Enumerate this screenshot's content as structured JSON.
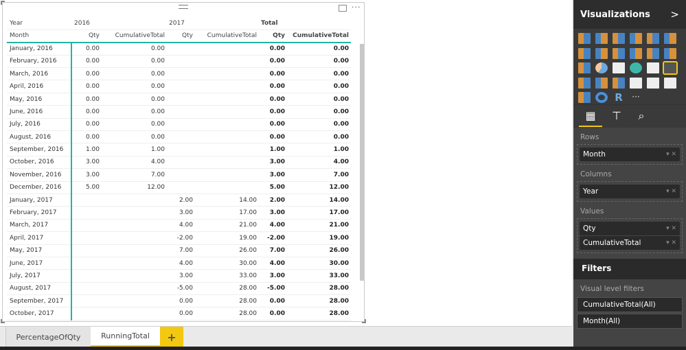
{
  "matrix": {
    "col_header": {
      "year_label": "Year",
      "y2016": "2016",
      "y2017": "2017",
      "total": "Total"
    },
    "sub_header": {
      "month_label": "Month",
      "qty": "Qty",
      "cum": "CumulativeTotal"
    },
    "rows": [
      [
        "January, 2016",
        "0.00",
        "0.00",
        "",
        "",
        "0.00",
        "0.00"
      ],
      [
        "February, 2016",
        "0.00",
        "0.00",
        "",
        "",
        "0.00",
        "0.00"
      ],
      [
        "March, 2016",
        "0.00",
        "0.00",
        "",
        "",
        "0.00",
        "0.00"
      ],
      [
        "April, 2016",
        "0.00",
        "0.00",
        "",
        "",
        "0.00",
        "0.00"
      ],
      [
        "May, 2016",
        "0.00",
        "0.00",
        "",
        "",
        "0.00",
        "0.00"
      ],
      [
        "June, 2016",
        "0.00",
        "0.00",
        "",
        "",
        "0.00",
        "0.00"
      ],
      [
        "July, 2016",
        "0.00",
        "0.00",
        "",
        "",
        "0.00",
        "0.00"
      ],
      [
        "August, 2016",
        "0.00",
        "0.00",
        "",
        "",
        "0.00",
        "0.00"
      ],
      [
        "September, 2016",
        "1.00",
        "1.00",
        "",
        "",
        "1.00",
        "1.00"
      ],
      [
        "October, 2016",
        "3.00",
        "4.00",
        "",
        "",
        "3.00",
        "4.00"
      ],
      [
        "November, 2016",
        "3.00",
        "7.00",
        "",
        "",
        "3.00",
        "7.00"
      ],
      [
        "December, 2016",
        "5.00",
        "12.00",
        "",
        "",
        "5.00",
        "12.00"
      ],
      [
        "January, 2017",
        "",
        "",
        "2.00",
        "14.00",
        "2.00",
        "14.00"
      ],
      [
        "February, 2017",
        "",
        "",
        "3.00",
        "17.00",
        "3.00",
        "17.00"
      ],
      [
        "March, 2017",
        "",
        "",
        "4.00",
        "21.00",
        "4.00",
        "21.00"
      ],
      [
        "April, 2017",
        "",
        "",
        "-2.00",
        "19.00",
        "-2.00",
        "19.00"
      ],
      [
        "May, 2017",
        "",
        "",
        "7.00",
        "26.00",
        "7.00",
        "26.00"
      ],
      [
        "June, 2017",
        "",
        "",
        "4.00",
        "30.00",
        "4.00",
        "30.00"
      ],
      [
        "July, 2017",
        "",
        "",
        "3.00",
        "33.00",
        "3.00",
        "33.00"
      ],
      [
        "August, 2017",
        "",
        "",
        "-5.00",
        "28.00",
        "-5.00",
        "28.00"
      ],
      [
        "September, 2017",
        "",
        "",
        "0.00",
        "28.00",
        "0.00",
        "28.00"
      ],
      [
        "October, 2017",
        "",
        "",
        "0.00",
        "28.00",
        "0.00",
        "28.00"
      ]
    ]
  },
  "visual_header": {
    "more": "···"
  },
  "tabs": [
    {
      "label": "PercentageOfQty",
      "active": false
    },
    {
      "label": "RunningTotal",
      "active": true
    }
  ],
  "add_tab": "+",
  "accent": "#f2c811",
  "panel": {
    "title": "Visualizations",
    "expand": ">",
    "viz_icons": [
      "stacked-bar",
      "stacked-column",
      "clustered-bar",
      "clustered-column",
      "100-stacked-bar",
      "100-stacked-column",
      "line",
      "area",
      "stacked-area",
      "line-column",
      "line-clustered-column",
      "ribbon",
      "scatter",
      "pie",
      "treemap",
      "map",
      "table",
      "matrix",
      "filled-map",
      "funnel",
      "gauge",
      "multi-row-card",
      "card",
      "kpi",
      "slicer",
      "donut",
      "r-visual",
      "more"
    ],
    "r_label": "R",
    "more_label": "···",
    "rows_label": "Rows",
    "rows": [
      "Month"
    ],
    "columns_label": "Columns",
    "columns": [
      "Year"
    ],
    "values_label": "Values",
    "values": [
      "Qty",
      "CumulativeTotal"
    ],
    "filters_title": "Filters",
    "visual_filters_label": "Visual level filters",
    "filters": [
      "CumulativeTotal(All)",
      "Month(All)"
    ]
  }
}
